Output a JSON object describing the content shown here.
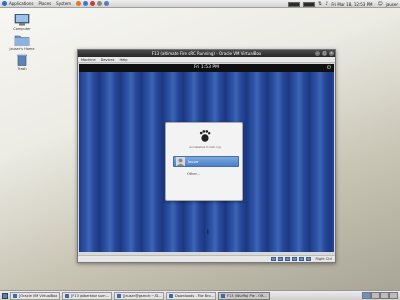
{
  "top_panel": {
    "menus": [
      "Applications",
      "Places",
      "System"
    ],
    "clock": "Fri Mar 18, 12:53 PM",
    "user": "jauser"
  },
  "desktop_icons": [
    {
      "label": "Computer"
    },
    {
      "label": "jauser's Home"
    },
    {
      "label": "Trash"
    }
  ],
  "vbox_window": {
    "title": "F13 (altimate Fire sRC Running) - Oracle VM VirtualBox",
    "menu": [
      "Machine",
      "Devices",
      "Help"
    ],
    "status_label": "Right Ctrl"
  },
  "guest": {
    "clock": "Fri 1:53 PM",
    "hostname": "annabelle13.milli.org",
    "user": "Jauser",
    "other": "Other..."
  },
  "taskbar": {
    "tasks": [
      {
        "label": "[Oracle VM VirtualBox",
        "active": false
      },
      {
        "label": "[F13 jalbertdor sum...",
        "active": false
      },
      {
        "label": "[jauser@gsmch:~/D...",
        "active": false
      },
      {
        "label": "Downloads - File Bro...",
        "active": false
      },
      {
        "label": "F13 (Wulffa) Ple - OR...",
        "active": true
      }
    ]
  },
  "colors": {
    "guest_bg": "#2f55a8",
    "selected_row": "#5b8fd4",
    "panel": "#dcdcdc"
  }
}
